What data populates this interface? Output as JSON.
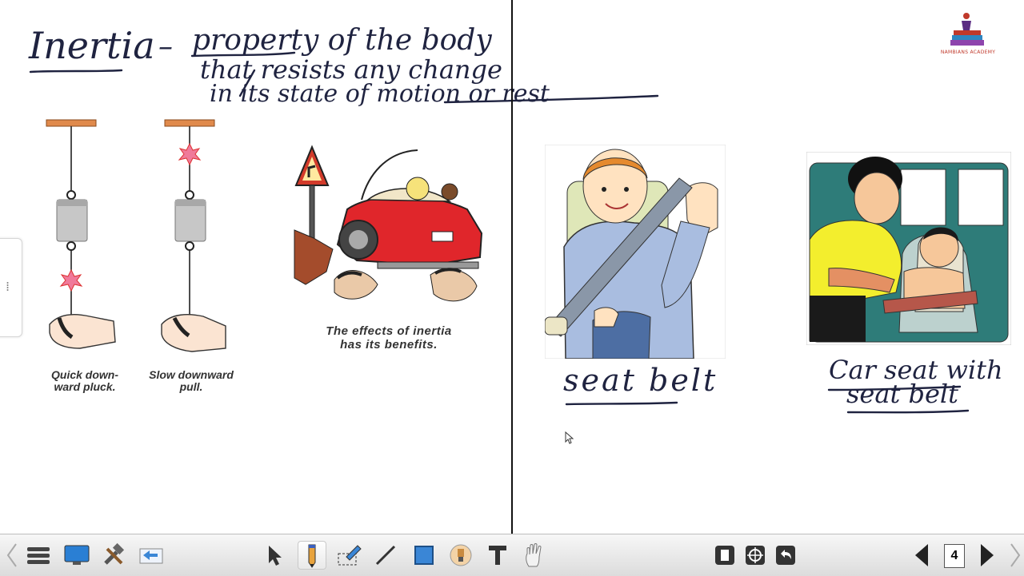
{
  "board": {
    "heading": {
      "word": "Inertia",
      "dash": "–",
      "line1": "property of the body",
      "line2": "that resists any change",
      "line3": "in its state of motion or rest"
    },
    "captions": {
      "quick": "Quick down-\nward pluck.",
      "slow": "Slow downward\npull.",
      "effects": "The effects of inertia\nhas its benefits."
    },
    "labels": {
      "seatbelt": "seat belt",
      "carseat_line1": "Car seat with",
      "carseat_line2": "seat belt"
    },
    "logo_text": "NAMBIANS ACADEMY",
    "accent_colors": {
      "ink": "#1f2340",
      "rod": "#e08a4c",
      "car": "#e0262b",
      "shirt_yellow": "#f3ee2d",
      "shirt_blue": "#a9bde0"
    }
  },
  "toolbar": {
    "left_icons": [
      "menu-icon",
      "monitor-icon",
      "tools-icon",
      "screen-capture-icon"
    ],
    "center_icons": [
      "select-arrow-icon",
      "pencil-icon",
      "eraser-icon",
      "line-icon",
      "rectangle-icon",
      "spotlight-icon",
      "text-tool-icon",
      "hand-icon"
    ],
    "right_icons": [
      "clipboard-icon",
      "target-icon",
      "undo-icon"
    ],
    "page_number": "4"
  }
}
